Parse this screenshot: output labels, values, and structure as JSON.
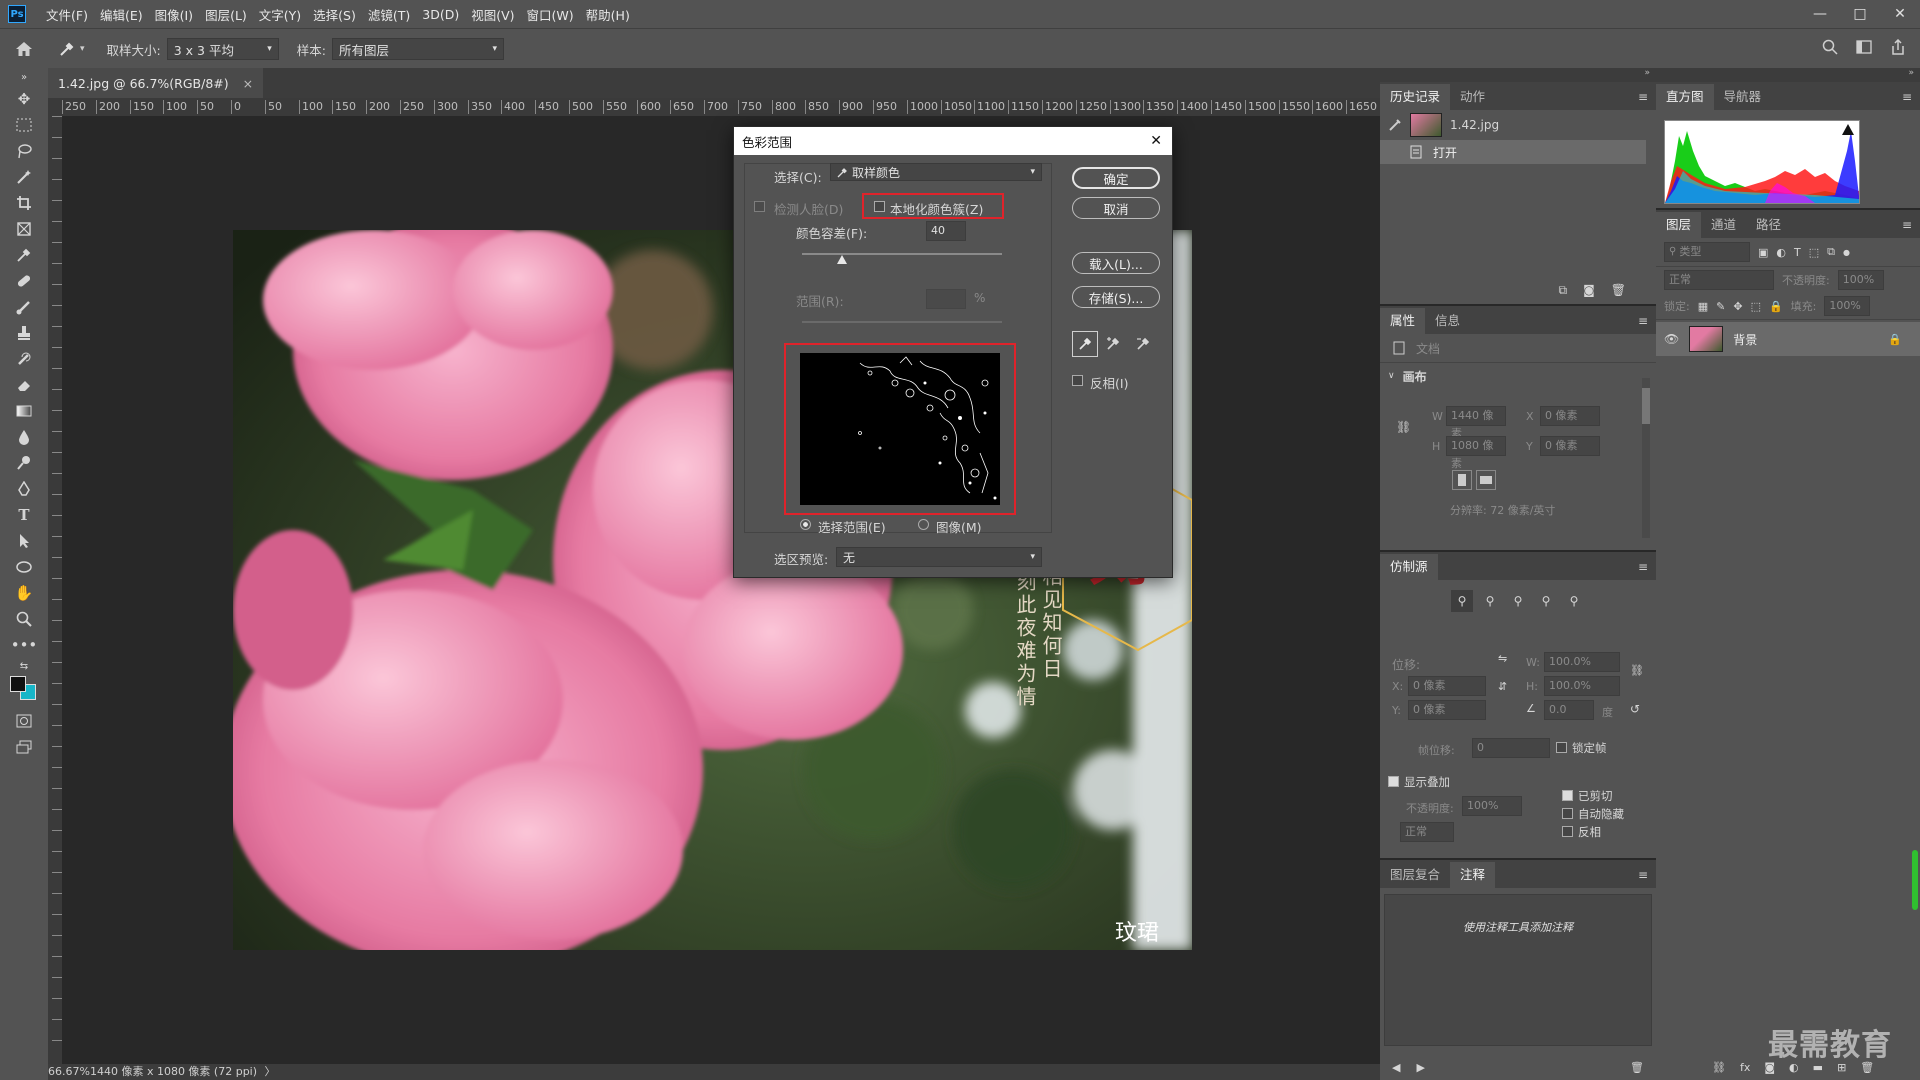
{
  "menubar": {
    "logo": "Ps",
    "items": [
      "文件(F)",
      "编辑(E)",
      "图像(I)",
      "图层(L)",
      "文字(Y)",
      "选择(S)",
      "滤镜(T)",
      "3D(D)",
      "视图(V)",
      "窗口(W)",
      "帮助(H)"
    ],
    "window_min": "—",
    "window_max": "□",
    "window_close": "✕"
  },
  "options": {
    "sample_size_label": "取样大小:",
    "sample_size_value": "3 x 3 平均",
    "sample_label": "样本:",
    "sample_value": "所有图层"
  },
  "document": {
    "tab_title": "1.42.jpg @ 66.7%(RGB/8#)",
    "tab_close": "×",
    "ruler_labels": [
      "250",
      "200",
      "150",
      "100",
      "50",
      "0",
      "50",
      "100",
      "150",
      "200",
      "250",
      "300",
      "350",
      "400",
      "450",
      "500",
      "550",
      "600",
      "650",
      "700",
      "750",
      "800",
      "850",
      "900",
      "950",
      "1000",
      "1050",
      "1100",
      "1150",
      "1200",
      "1250",
      "1300",
      "1350",
      "1400",
      "1450",
      "1500",
      "1550",
      "1600",
      "1650"
    ],
    "status": "66.67%",
    "status_size": "1440 像素 x 1080 像素 (72 ppi)",
    "status_arrow": "〉",
    "image_text_big": "刻",
    "image_poem_col1": "相思相见知何日",
    "image_poem_col2": "此刻此夜难为情",
    "image_signature": "玟珺"
  },
  "dialog": {
    "title": "色彩范围",
    "close": "✕",
    "select_label": "选择(C):",
    "select_value": "取样颜色",
    "detect_faces_label": "检测人脸(D)",
    "localized_label": "本地化颜色簇(Z)",
    "fuzziness_label": "颜色容差(F):",
    "fuzziness_value": "40",
    "fuzziness_level": 0.2,
    "range_label": "范围(R):",
    "range_unit": "%",
    "ok": "确定",
    "cancel": "取消",
    "load": "载入(L)...",
    "save": "存储(S)...",
    "invert_label": "反相(I)",
    "radio_selection": "选择范围(E)",
    "radio_image": "图像(M)",
    "preview_label": "选区预览:",
    "preview_value": "无"
  },
  "history_panel": {
    "tabs": [
      "历史记录",
      "动作"
    ],
    "snapshot_name": "1.42.jpg",
    "state_open": "打开"
  },
  "histogram_panel": {
    "tabs": [
      "直方图",
      "导航器"
    ],
    "warning": "!"
  },
  "layers_panel": {
    "tabs": [
      "图层",
      "通道",
      "路径"
    ],
    "filter_kind": "类型",
    "blend_mode": "正常",
    "opacity_label": "不透明度:",
    "opacity_value": "100%",
    "lock_label": "锁定:",
    "fill_label": "填充:",
    "fill_value": "100%",
    "layer_name": "背景"
  },
  "properties_panel": {
    "tabs": [
      "属性",
      "信息"
    ],
    "doc_label": "文档",
    "canvas_section": "画布",
    "w_label": "W",
    "w_value": "1440 像素",
    "h_label": "H",
    "h_value": "1080 像素",
    "x_label": "X",
    "x_value": "0 像素",
    "y_label": "Y",
    "y_value": "0 像素",
    "resolution": "分辨率: 72 像素/英寸"
  },
  "clone_panel": {
    "tabs": [
      "仿制源"
    ],
    "offset_label": "位移:",
    "x_label": "X:",
    "x_value": "0 像素",
    "y_label": "Y:",
    "y_value": "0 像素",
    "w_label": "W:",
    "w_value": "100.0%",
    "h_label": "H:",
    "h_value": "100.0%",
    "angle_value": "0.0",
    "angle_unit": "度",
    "frame_offset_label": "帧位移:",
    "frame_offset_value": "0",
    "lock_frame": "锁定帧",
    "show_overlay": "显示叠加",
    "opacity_label": "不透明度:",
    "opacity_value": "100%",
    "clipped": "已剪切",
    "auto_hide": "自动隐藏",
    "invert": "反相",
    "blend": "正常"
  },
  "notes_panel": {
    "tabs": [
      "图层复合",
      "注释"
    ],
    "hint": "使用注释工具添加注释"
  },
  "watermark": "最需教育"
}
